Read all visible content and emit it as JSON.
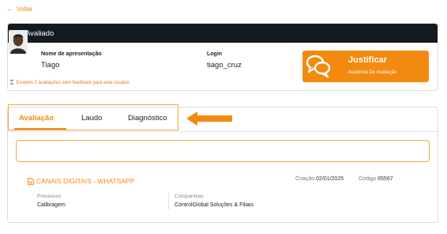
{
  "nav": {
    "back_label": "Voltar"
  },
  "evaluated": {
    "section_title": "Avaliado",
    "display_name_label": "Nome de apresentação",
    "display_name": "Tiago",
    "login_label": "Login",
    "login": "tiago_cruz",
    "warning": "Existem 2 avaliações sem feedback para este usuário"
  },
  "justify_button": {
    "title": "Justificar",
    "subtitle": "Ausência De Avaliação"
  },
  "tabs": [
    {
      "label": "Avaliação",
      "active": true
    },
    {
      "label": "Laudo",
      "active": false
    },
    {
      "label": "Diagnóstico",
      "active": false
    }
  ],
  "evaluation": {
    "title": "CANAIS DIGITAIS - WHATSAPP",
    "created_label": "Criação",
    "created_value": "02/01/2025",
    "code_label": "Código",
    "code_value": "65567",
    "process_label": "Processos",
    "process_value": "Calibragem",
    "company_label": "Companhias",
    "company_value": "ControlGlobal Soluções & Filiais"
  },
  "colors": {
    "accent": "#f28a10",
    "header": "#141a22"
  }
}
